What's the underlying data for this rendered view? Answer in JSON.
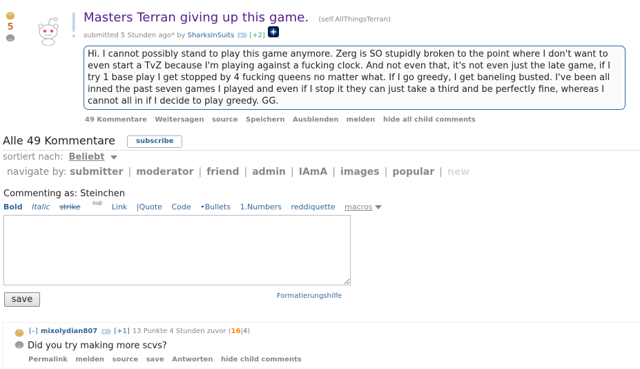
{
  "post": {
    "score": "5",
    "title": "Masters Terran giving up this game.",
    "domain": "(self.AllThingsTerran)",
    "submitted": "submitted 5 Stunden ago* by",
    "author": "SharksInSuits",
    "author_karma": "[+2]",
    "selftext": "Hi. I cannot possibly stand to play this game anymore. Zerg is SO stupidly broken to the point where I don't want to even start a TvZ because I'm playing against a fucking clock. And not even that, it's not even just the late game, if I try 1 base play I get stopped by 4 fucking queens no matter what. If I go greedy, I get baneling busted. I've been all inned the past seven games I played and even if I stop it they can just take a third and be perfectly fine, whereas I cannot all in if I decide to play greedy. GG.",
    "buttons": [
      "49 Kommentare",
      "Weitersagen",
      "source",
      "Speichern",
      "Ausblenden",
      "melden",
      "hide all child comments"
    ],
    "colors": {
      "title": "#551a8b",
      "score": "#c6772e",
      "link": "#336699"
    },
    "icons": [
      "upvote-icon",
      "downvote-icon",
      "self-post-thumbnail-icon",
      "friend-tag-icon",
      "flair-icon"
    ]
  },
  "comments_header": {
    "title": "Alle 49 Kommentare",
    "subscribe_label": "subscribe",
    "sort_label": "sortiert nach:",
    "sort_value": "Beliebt",
    "navigate_label": "navigate by:",
    "nav_items": [
      "submitter",
      "moderator",
      "friend",
      "admin",
      "IAmA",
      "images",
      "popular",
      "new"
    ]
  },
  "comment_form": {
    "commenting_as": "Commenting as: Steinchen",
    "toolbar": {
      "bold": "Bold",
      "italic": "Italic",
      "strike": "strike",
      "sup": "sup",
      "link": "Link",
      "quote": "|Quote",
      "code": "Code",
      "bullets": "•Bullets",
      "numbers": "1.Numbers",
      "reddiquette": "reddiquette",
      "macros": "macros"
    },
    "textarea_value": "",
    "save_label": "save",
    "format_help": "Formatierungshilfe"
  },
  "comment": {
    "expand": "[–]",
    "author": "mixolydian807",
    "author_karma": "[+1]",
    "meta": "13 Punkte 4 Stunden zuvor (",
    "ups": "16",
    "sep": "|",
    "downs": "4",
    "close": ")",
    "body": "Did you try making more scvs?",
    "buttons": [
      "Permalink",
      "melden",
      "source",
      "save",
      "Antworten",
      "hide child comments"
    ]
  }
}
